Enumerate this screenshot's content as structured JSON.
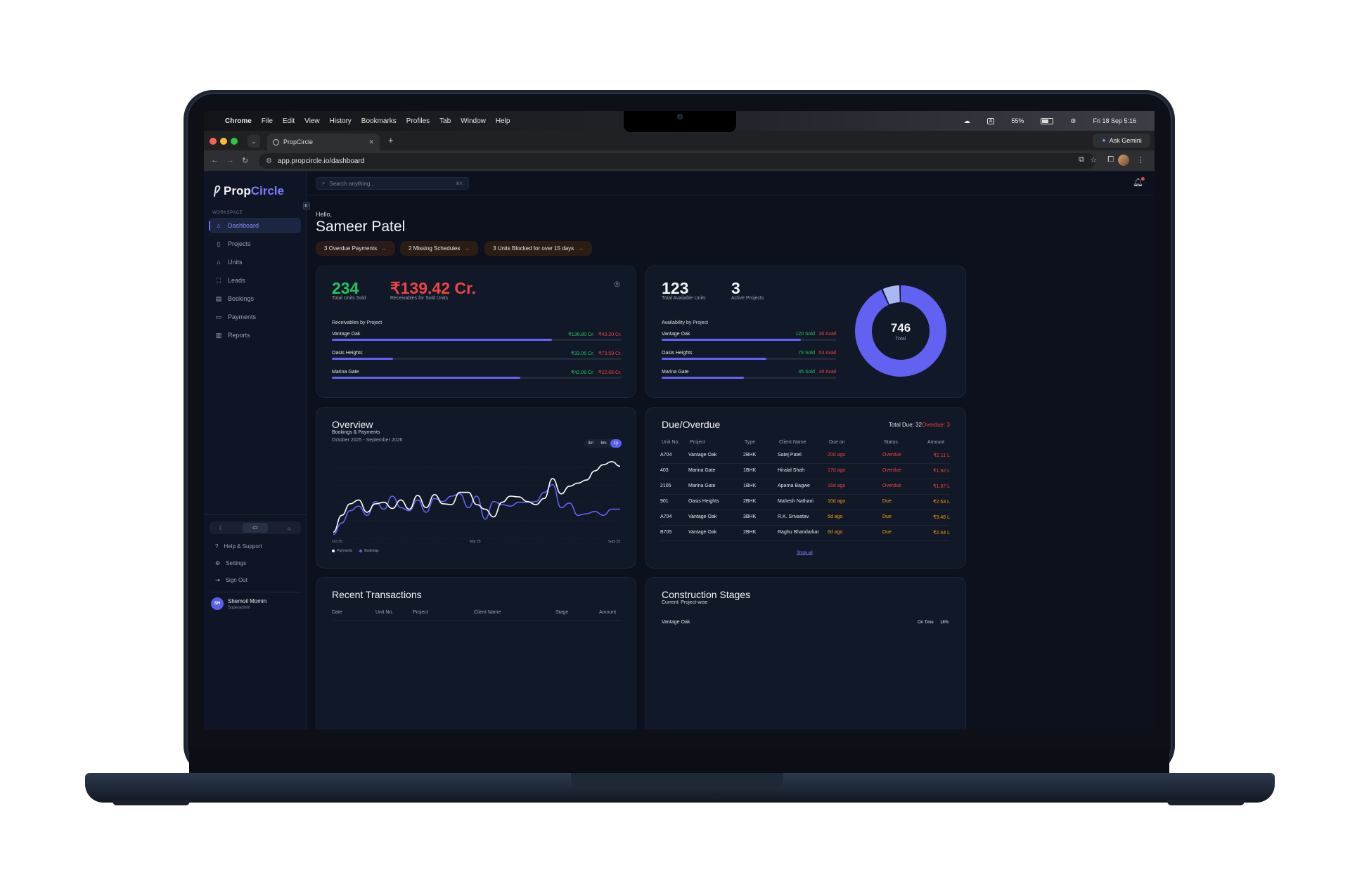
{
  "menubar": {
    "items": [
      "Chrome",
      "File",
      "Edit",
      "View",
      "History",
      "Bookmarks",
      "Profiles",
      "Tab",
      "Window",
      "Help"
    ],
    "battery": "55%",
    "datetime": "Fri 18 Sep  5:16"
  },
  "browser": {
    "tab_title": "PropCircle",
    "url": "app.propcircle.io/dashboard",
    "gemini_label": "Ask Gemini"
  },
  "sidebar": {
    "brand_first": "Prop",
    "brand_second": "Circle",
    "section_label": "WORKSPACE",
    "items": [
      {
        "label": "Dashboard",
        "icon": "home-icon",
        "active": true
      },
      {
        "label": "Projects",
        "icon": "document-icon"
      },
      {
        "label": "Units",
        "icon": "building-icon"
      },
      {
        "label": "Leads",
        "icon": "user-scan-icon"
      },
      {
        "label": "Bookings",
        "icon": "book-icon"
      },
      {
        "label": "Payments",
        "icon": "card-icon"
      },
      {
        "label": "Reports",
        "icon": "bar-chart-icon"
      }
    ],
    "footer": [
      {
        "label": "Help & Support",
        "icon": "help-icon"
      },
      {
        "label": "Settings",
        "icon": "gear-icon"
      },
      {
        "label": "Sign Out",
        "icon": "logout-icon"
      }
    ],
    "user": {
      "initials": "SH",
      "name": "Shemoil Momin",
      "role": "Superadmin"
    }
  },
  "header": {
    "search_placeholder": "Search anything...",
    "search_shortcut": "⌘K",
    "greeting": "Hello,",
    "user_name": "Sameer Patel",
    "alerts": [
      "3 Overdue Payments",
      "2 Missing Schedules",
      "3 Units Blocked for over 15 days"
    ]
  },
  "sales_card": {
    "units_sold": "234",
    "units_sold_label": "Total Units Sold",
    "receivables": "₹139.42 Cr.",
    "receivables_label": "Receivables for Sold Units",
    "section": "Receivables by Project",
    "projects": [
      {
        "name": "Vantage Oak",
        "received": "₹136.80 Cr.",
        "pending": "₹43.20 Cr.",
        "progress": 0.76
      },
      {
        "name": "Oasis Heights",
        "received": "₹33.06 Cr.",
        "pending": "₹73.59 Cr.",
        "progress": 0.21
      },
      {
        "name": "Marina Gate",
        "received": "₹42.09 Cr.",
        "pending": "₹22.66 Cr.",
        "progress": 0.65
      }
    ]
  },
  "inventory_card": {
    "available": "123",
    "available_label": "Total Available Units",
    "active_projects": "3",
    "active_projects_label": "Active Projects",
    "section": "Availability by Project",
    "projects": [
      {
        "name": "Vantage Oak",
        "sold": "120 Sold",
        "avail": "30 Avail",
        "progress": 0.8
      },
      {
        "name": "Oasis Heights",
        "sold": "79 Sold",
        "avail": "53 Avail",
        "progress": 0.6
      },
      {
        "name": "Marina Gate",
        "sold": "35 Sold",
        "avail": "40 Avail",
        "progress": 0.47
      }
    ],
    "donut_total": "746",
    "donut_total_label": "Total",
    "donut_segments": [
      {
        "value": 0.935,
        "color": "#6161f2"
      },
      {
        "value": 0.065,
        "color": "#a9b8f5"
      }
    ]
  },
  "overview": {
    "title": "Overview",
    "subtitle": "Bookings & Payments",
    "period": "October 2025 - September 2026",
    "ranges": [
      "3m",
      "6m",
      "1y"
    ],
    "selected_range": "1y",
    "x_ticks": [
      "Oct 25",
      "Mar 25",
      "Sept 25"
    ],
    "legend": [
      {
        "name": "Payments",
        "color": "#ffffff"
      },
      {
        "name": "Bookings",
        "color": "#6262f5"
      }
    ]
  },
  "chart_data": {
    "type": "line",
    "series": [
      {
        "name": "Payments",
        "values": [
          8,
          30,
          45,
          50,
          34,
          45,
          47,
          39,
          50,
          38,
          56,
          40,
          57,
          45,
          44,
          60,
          60,
          44,
          38,
          28,
          47,
          55,
          54,
          48,
          44,
          52,
          78,
          58,
          68,
          72,
          76,
          88,
          96,
          100,
          94
        ]
      },
      {
        "name": "Bookings",
        "values": [
          5,
          20,
          36,
          42,
          30,
          48,
          38,
          55,
          40,
          36,
          50,
          34,
          52,
          48,
          55,
          58,
          40,
          55,
          25,
          48,
          44,
          42,
          47,
          47,
          48,
          60,
          70,
          40,
          46,
          30,
          32,
          35,
          30,
          38,
          38
        ]
      }
    ],
    "ylim": [
      0,
      110
    ],
    "x_ticks": [
      "Oct 25",
      "Mar 25",
      "Sept 25"
    ]
  },
  "due": {
    "title": "Due/Overdue",
    "total_due": "Total Due: 32",
    "overdue": "Overdue: 3",
    "columns": [
      "Unit No.",
      "Project",
      "Type",
      "Client Name",
      "Due on",
      "Status",
      "Amount"
    ],
    "rows": [
      [
        "A704",
        "Vantage Oak",
        "2BHK",
        "Satej Patel",
        "20d ago",
        "Overdue",
        "₹2.11 L"
      ],
      [
        "403",
        "Marina Gate",
        "1BHK",
        "Hiralal Shah",
        "17d ago",
        "Overdue",
        "₹1.92 L"
      ],
      [
        "2105",
        "Marina Gate",
        "1BHK",
        "Aparna Bagwe",
        "16d ago",
        "Overdue",
        "₹1.87 L"
      ],
      [
        "901",
        "Oasis Heights",
        "2BHK",
        "Mahesh Nathani",
        "10d ago",
        "Due",
        "₹2.53 L"
      ],
      [
        "A704",
        "Vantage Oak",
        "3BHK",
        "R.K. Srivastav",
        "6d ago",
        "Due",
        "₹3.46 L"
      ],
      [
        "B705",
        "Vantage Oak",
        "2BHK",
        "Raghu Bhandarkar",
        "6d ago",
        "Due",
        "₹2.44 L"
      ]
    ],
    "show_all": "Show all"
  },
  "transactions": {
    "title": "Recent Transactions",
    "columns": [
      "Date",
      "Unit No.",
      "Project",
      "Client Name",
      "Stage",
      "Amount"
    ]
  },
  "construction": {
    "title": "Construction Stages",
    "subtitle": "Current: Project-wise",
    "first_row": "Vantage Oak",
    "first_status": "On Time",
    "first_percent": "18%"
  }
}
